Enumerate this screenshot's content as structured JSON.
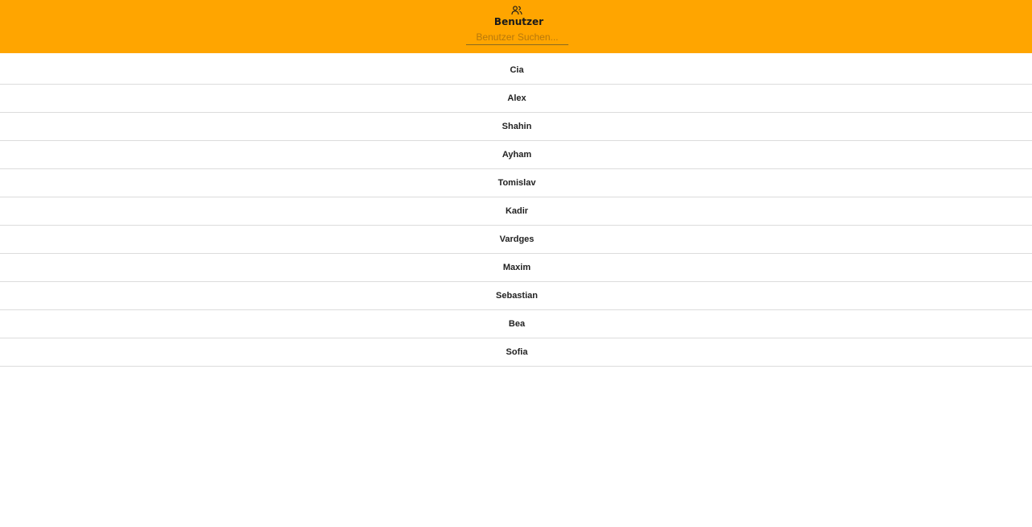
{
  "header": {
    "icon": "users-icon",
    "title": "Benutzer",
    "background_color": "#ffa500"
  },
  "search": {
    "placeholder": "Benutzer Suchen...",
    "value": ""
  },
  "users": [
    {
      "name": "Cia"
    },
    {
      "name": "Alex"
    },
    {
      "name": "Shahin"
    },
    {
      "name": "Ayham"
    },
    {
      "name": "Tomislav"
    },
    {
      "name": "Kadir"
    },
    {
      "name": "Vardges"
    },
    {
      "name": "Maxim"
    },
    {
      "name": "Sebastian"
    },
    {
      "name": "Bea"
    },
    {
      "name": "Sofia"
    }
  ]
}
